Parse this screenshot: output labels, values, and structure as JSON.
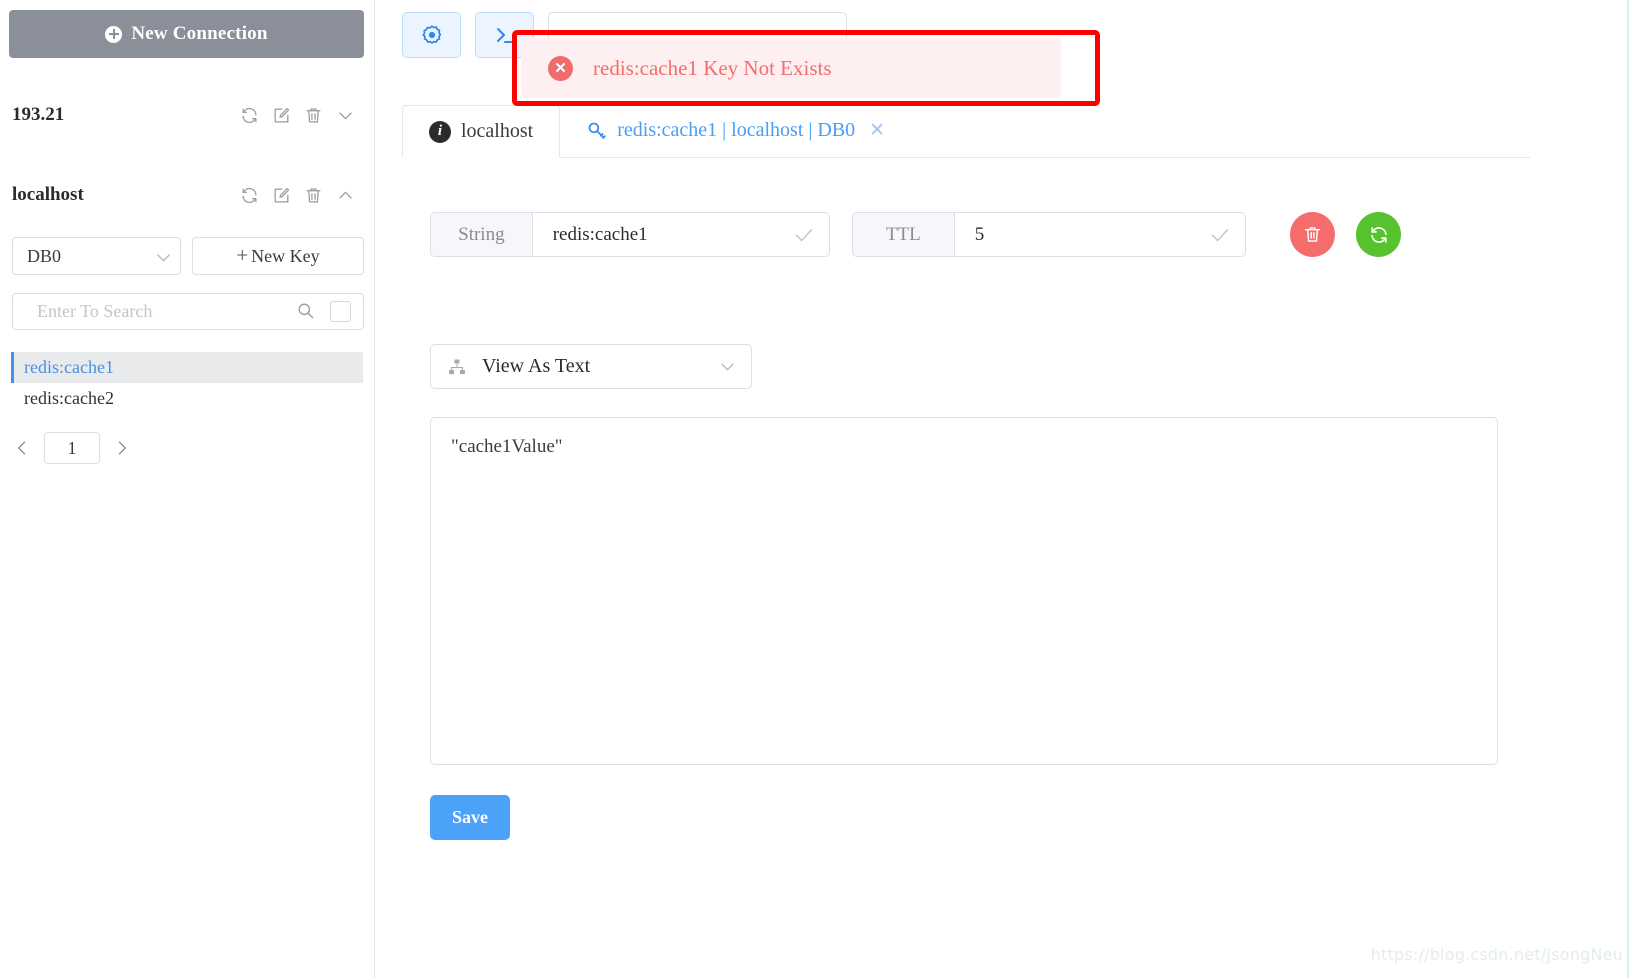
{
  "sidebar": {
    "new_connection_label": "New Connection",
    "new_connection_icon": "plus-circle-icon",
    "connections": [
      {
        "name": "193.21",
        "expanded": false,
        "icons": [
          "refresh-icon",
          "edit-icon",
          "trash-icon",
          "chevron-down-icon"
        ]
      },
      {
        "name": "localhost",
        "expanded": true,
        "icons": [
          "refresh-icon",
          "edit-icon",
          "trash-icon",
          "chevron-up-icon"
        ]
      }
    ],
    "db_select": {
      "value": "DB0",
      "icon": "chevron-down-icon"
    },
    "new_key_label": "New Key",
    "new_key_icon": "plus-icon",
    "search": {
      "value": "",
      "placeholder": "Enter To Search",
      "icon": "search-icon",
      "checkbox_icon": "square-checkbox-icon"
    },
    "keys": [
      {
        "label": "redis:cache1",
        "selected": true
      },
      {
        "label": "redis:cache2",
        "selected": false
      }
    ],
    "pager": {
      "prev_icon": "chevron-left-icon",
      "page": "1",
      "next_icon": "chevron-right-icon"
    }
  },
  "toolbar": {
    "buttons": [
      {
        "icon": "settings-gear-icon",
        "label": ""
      },
      {
        "icon": "terminal-icon",
        "label": ""
      }
    ],
    "wide_field_text": ""
  },
  "tabs": [
    {
      "label": "localhost",
      "icon": "info-icon",
      "selected": true,
      "closable": false
    },
    {
      "label": "redis:cache1 | localhost | DB0",
      "icon": "key-search-icon",
      "selected": false,
      "closable": true,
      "close_icon": "close-icon"
    }
  ],
  "editor": {
    "key_field": {
      "prefix": "String",
      "value": "redis:cache1",
      "check_icon": "check-icon"
    },
    "ttl_field": {
      "prefix": "TTL",
      "value": "5",
      "check_icon": "check-icon"
    },
    "delete_button": {
      "icon": "trash-icon",
      "color": "#f56c6c"
    },
    "refresh_button": {
      "icon": "refresh-icon",
      "color": "#56c22d"
    },
    "view_as": {
      "value": "View As Text",
      "icon": "sitemap-icon",
      "caret_icon": "chevron-down-icon"
    },
    "value_text": "\"cache1Value\"",
    "save_label": "Save"
  },
  "toast": {
    "message": "redis:cache1 Key Not Exists",
    "icon": "error-circle-icon",
    "highlight_color": "#fe0000",
    "background": "#fef0f0",
    "text_color": "#f56c6c"
  },
  "watermark": {
    "text": "https://blog.csdn.net/JsongNeu"
  }
}
